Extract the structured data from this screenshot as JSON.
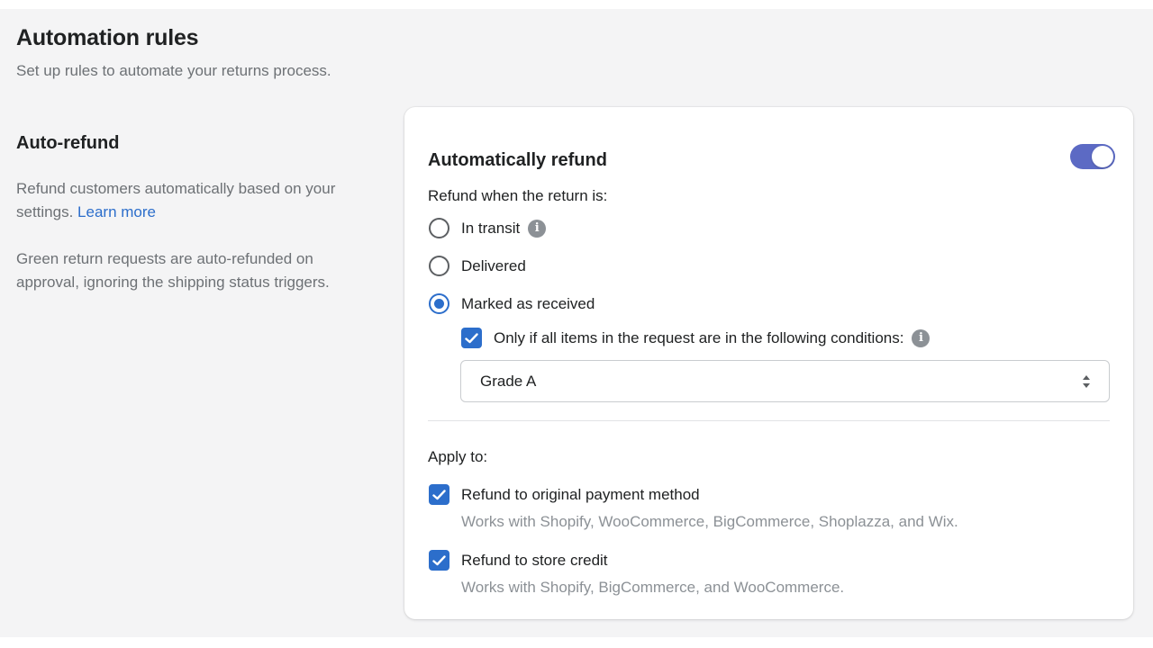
{
  "header": {
    "title": "Automation rules",
    "subtitle": "Set up rules to automate your returns process."
  },
  "section": {
    "title": "Auto-refund",
    "description": "Refund customers automatically based on your settings.",
    "learn_more": "Learn more",
    "note": "Green return requests are auto-refunded on approval, ignoring the shipping status triggers."
  },
  "card": {
    "title": "Automatically refund",
    "toggle_on": true,
    "refund_when_label": "Refund when the return is:",
    "options": [
      {
        "label": "In transit",
        "selected": false
      },
      {
        "label": "Delivered",
        "selected": false
      },
      {
        "label": "Marked as received",
        "selected": true
      }
    ],
    "condition_checkbox": {
      "label": "Only if all items in the request are in the following conditions:",
      "checked": true
    },
    "condition_select": {
      "value": "Grade A"
    },
    "apply_to_label": "Apply to:",
    "apply_options": [
      {
        "label": "Refund to original payment method",
        "help": "Works with Shopify, WooCommerce, BigCommerce, Shoplazza, and Wix.",
        "checked": true
      },
      {
        "label": "Refund to store credit",
        "help": "Works with Shopify, BigCommerce, and WooCommerce.",
        "checked": true
      }
    ]
  },
  "colors": {
    "toggle": "#5c6ac4",
    "primary": "#2c6ecb",
    "link": "#2c6ecb"
  },
  "icons": {
    "info": "info-icon",
    "check": "checkmark-icon",
    "select": "select-arrows-icon"
  }
}
